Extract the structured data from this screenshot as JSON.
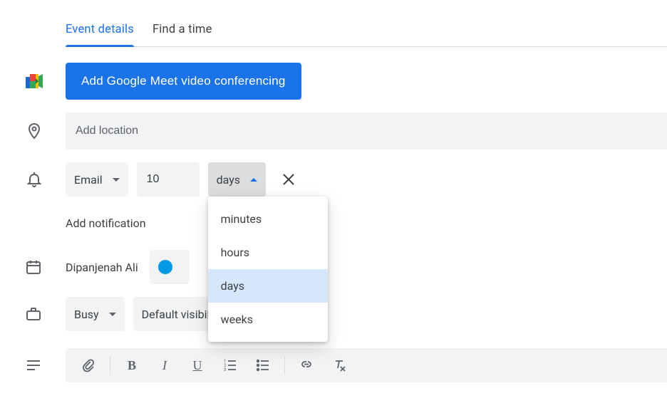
{
  "tabs": {
    "details": "Event details",
    "findtime": "Find a time"
  },
  "meet": {
    "button": "Add Google Meet video conferencing"
  },
  "location": {
    "placeholder": "Add location"
  },
  "notification": {
    "method": "Email",
    "value": "10",
    "unit": "days",
    "add": "Add notification",
    "options": {
      "minutes": "minutes",
      "hours": "hours",
      "days": "days",
      "weeks": "weeks"
    }
  },
  "organizer": {
    "name": "Dipanjenah Ali"
  },
  "availability": {
    "busy": "Busy",
    "visibility": "Default visibility"
  }
}
